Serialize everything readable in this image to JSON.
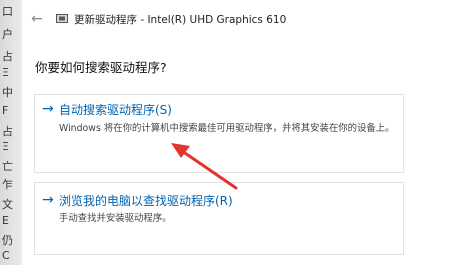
{
  "left_strip": {
    "chars": [
      "口",
      "户",
      "占",
      "Ξ",
      "中",
      "F",
      "占",
      "Ξ",
      "亡",
      "乍",
      "文",
      "E",
      "仍",
      "C"
    ]
  },
  "titlebar": {
    "back_icon": "back-arrow-icon",
    "app_icon": "driver-chip-icon",
    "title": "更新驱动程序 - Intel(R) UHD Graphics 610"
  },
  "main": {
    "question": "你要如何搜索驱动程序?",
    "options": [
      {
        "arrow": "→",
        "title": "自动搜索驱动程序(S)",
        "description": "Windows 将在你的计算机中搜索最佳可用驱动程序，并将其安装在你的设备上。"
      },
      {
        "arrow": "→",
        "title": "浏览我的电脑以查找驱动程序(R)",
        "description": "手动查找并安装驱动程序。"
      }
    ]
  },
  "colors": {
    "accent": "#0063b1",
    "annotation": "#e3342f"
  }
}
